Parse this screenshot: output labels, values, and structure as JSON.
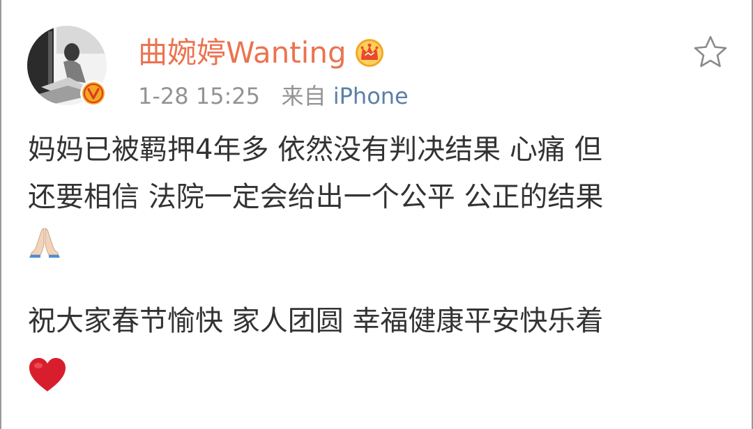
{
  "user": {
    "name": "曲婉婷Wanting",
    "timestamp": "1-28 15:25",
    "source_prefix": "来自",
    "source": "iPhone",
    "verified_mark": "V"
  },
  "post": {
    "line1": "妈妈已被羁押4年多 依然没有判决结果 心痛 但",
    "line2": "还要相信 法院一定会给出一个公平 公正的结果",
    "line3": "祝大家春节愉快 家人团圆 幸福健康平安快乐着"
  },
  "icons": {
    "crown": "crown-icon",
    "verified": "verified-badge-icon",
    "star": "star-outline-icon",
    "pray": "folded-hands-emoji",
    "heart": "red-heart-emoji"
  },
  "colors": {
    "username": "#eb7350",
    "crown": "#f5a623",
    "verified": "#f5a623",
    "source_link": "#5b7fa6",
    "heart": "#d81e2c",
    "text": "#333333",
    "meta": "#939393"
  }
}
